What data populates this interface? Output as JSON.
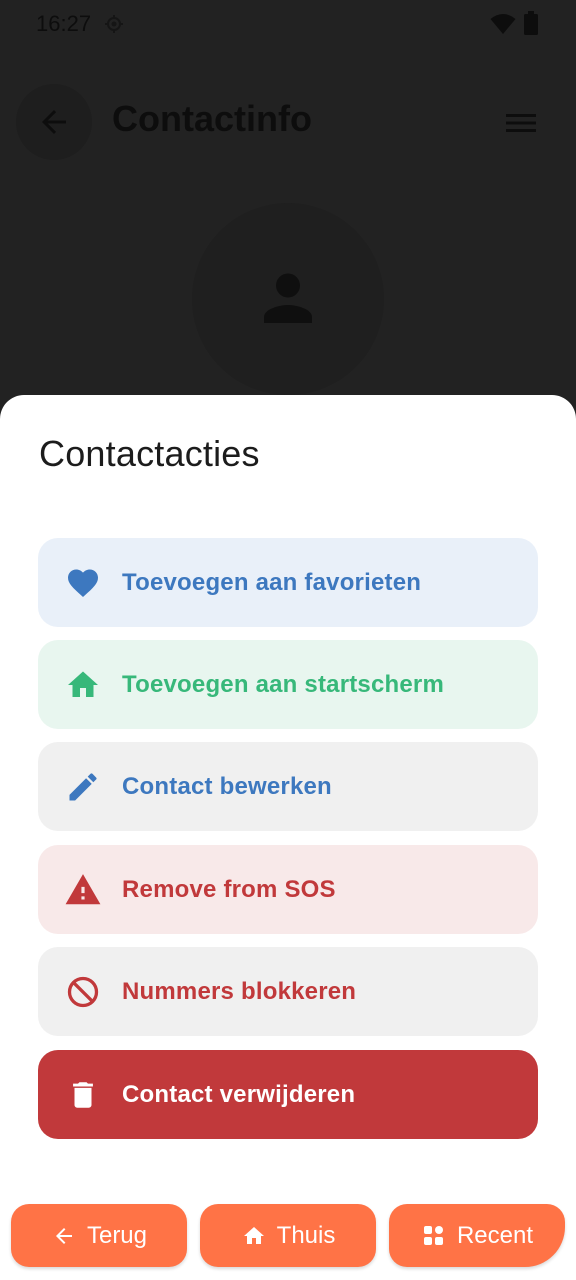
{
  "status_bar": {
    "time": "16:27",
    "icons": [
      "location-icon",
      "wifi-icon",
      "battery-icon"
    ]
  },
  "app_bar": {
    "title": "Contactinfo",
    "back_icon": "arrow-left-icon",
    "menu_icon": "menu-icon"
  },
  "contact": {
    "avatar_icon": "person-icon"
  },
  "sheet": {
    "title": "Contactacties",
    "actions": [
      {
        "label": "Toevoegen aan favorieten",
        "icon": "heart-icon",
        "color": "#3d78bf",
        "bg": "#e9f0f9"
      },
      {
        "label": "Toevoegen aan startscherm",
        "icon": "home-icon",
        "color": "#37b87a",
        "bg": "#e8f6ef"
      },
      {
        "label": "Contact bewerken",
        "icon": "pencil-icon",
        "color": "#3d78bf",
        "bg": "#f0f0f0"
      },
      {
        "label": "Remove from SOS",
        "icon": "warning-icon",
        "color": "#c1393b",
        "bg": "#f8e9e9"
      },
      {
        "label": "Nummers blokkeren",
        "icon": "block-icon",
        "color": "#c1393b",
        "bg": "#f0f0f0"
      },
      {
        "label": "Contact verwijderen",
        "icon": "trash-icon",
        "color": "#ffffff",
        "bg": "#c1393b"
      }
    ]
  },
  "bottom_nav": {
    "back_label": "Terug",
    "home_label": "Thuis",
    "recent_label": "Recent",
    "accent": "#ff7346"
  }
}
